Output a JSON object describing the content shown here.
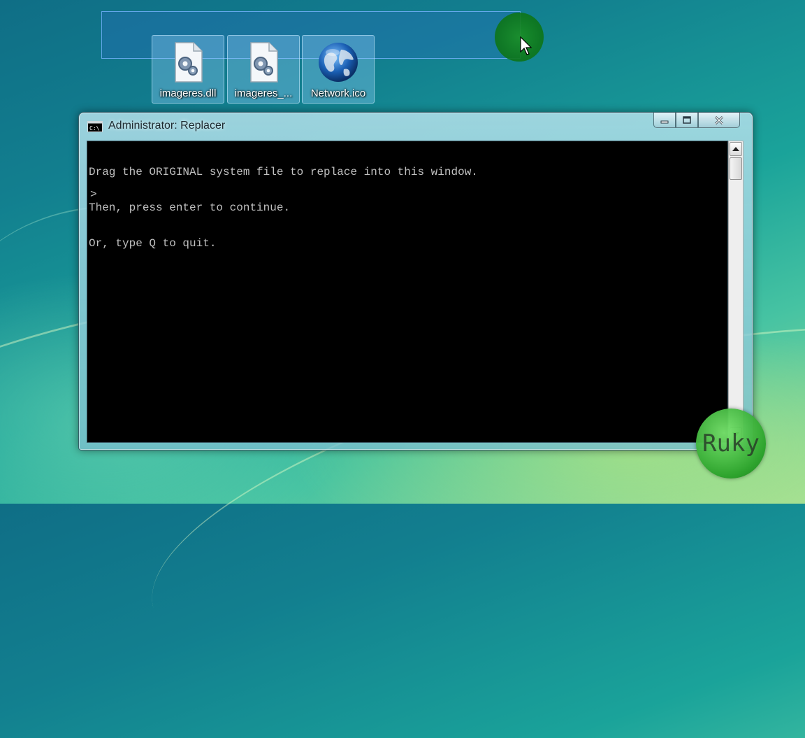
{
  "desktop": {
    "icons": [
      {
        "label": "imageres.dll",
        "icon": "dll-file-icon"
      },
      {
        "label": "imageres_...",
        "icon": "dll-file-icon"
      },
      {
        "label": "Network.ico",
        "icon": "globe-icon"
      }
    ]
  },
  "window": {
    "title": "Administrator:  Replacer",
    "title_icon": "console-icon",
    "buttons": {
      "minimize": "minimize-icon",
      "maximize": "maximize-icon",
      "close": "close-icon"
    }
  },
  "console": {
    "lines": [
      "Drag the ORIGINAL system file to replace into this window.",
      "Then, press enter to continue.",
      "Or, type Q to quit."
    ],
    "prompt": ">"
  },
  "watermark": {
    "text": "Ruky"
  },
  "colors": {
    "console_bg": "#000000",
    "console_fg": "#c0c0c0",
    "cursor_halo": "#1a8f22"
  }
}
